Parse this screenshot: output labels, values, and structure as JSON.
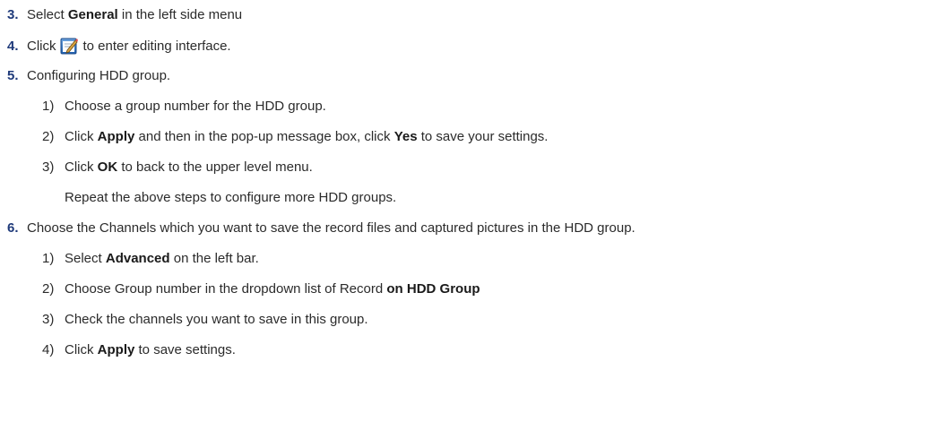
{
  "steps": {
    "s3": {
      "num": "3.",
      "pre": "Select ",
      "bold": "General",
      "post": " in the left side menu"
    },
    "s4": {
      "num": "4.",
      "pre": "Click",
      "icon": "edit-icon",
      "post": "to enter editing interface."
    },
    "s5": {
      "num": "5.",
      "text": "Configuring HDD group.",
      "sub": [
        {
          "num": "1)",
          "text": "Choose a group number for the HDD group."
        },
        {
          "num": "2)",
          "pre": "Click ",
          "bold1": "Apply",
          "mid": " and then in the pop-up message box, click ",
          "bold2": "Yes",
          "post": " to save your settings."
        },
        {
          "num": "3)",
          "pre": "Click ",
          "bold": "OK",
          "post": " to back to the upper level menu."
        }
      ],
      "note": "Repeat the above steps to configure more HDD groups."
    },
    "s6": {
      "num": "6.",
      "text": "Choose the Channels which you want to save the record files and captured pictures in the HDD group.",
      "sub": [
        {
          "num": "1)",
          "pre": "Select ",
          "bold": "Advanced",
          "post": " on the left bar."
        },
        {
          "num": "2)",
          "pre": "Choose Group number in the dropdown list of Record ",
          "bold": "on HDD Group"
        },
        {
          "num": "3)",
          "text": "Check the channels you want to save in this group."
        },
        {
          "num": "4)",
          "pre": "Click ",
          "bold": "Apply",
          "post": " to save settings."
        }
      ]
    }
  }
}
